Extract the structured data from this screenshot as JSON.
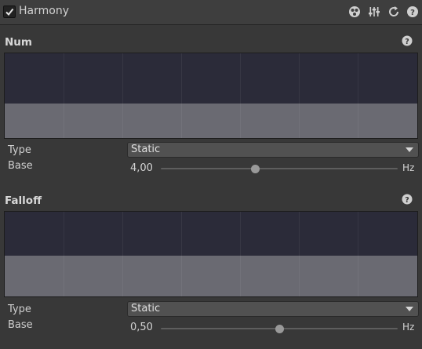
{
  "header": {
    "title": "Harmony",
    "enabled": true,
    "icons": [
      "preset-icon",
      "sliders-icon",
      "reset-icon",
      "help-icon"
    ]
  },
  "sections": [
    {
      "title": "Num",
      "type_label": "Type",
      "type_value": "Static",
      "base_label": "Base",
      "base_value": "4,00",
      "unit": "Hz",
      "slider_fraction": 0.4,
      "graph_fill_fraction": 0.41
    },
    {
      "title": "Falloff",
      "type_label": "Type",
      "type_value": "Static",
      "base_label": "Base",
      "base_value": "0,50",
      "unit": "Hz",
      "slider_fraction": 0.5,
      "graph_fill_fraction": 0.48
    }
  ],
  "colors": {
    "background": "#383838",
    "graph_background": "#2b2b39",
    "graph_fill": "#6a6a72",
    "dropdown": "#515151"
  }
}
